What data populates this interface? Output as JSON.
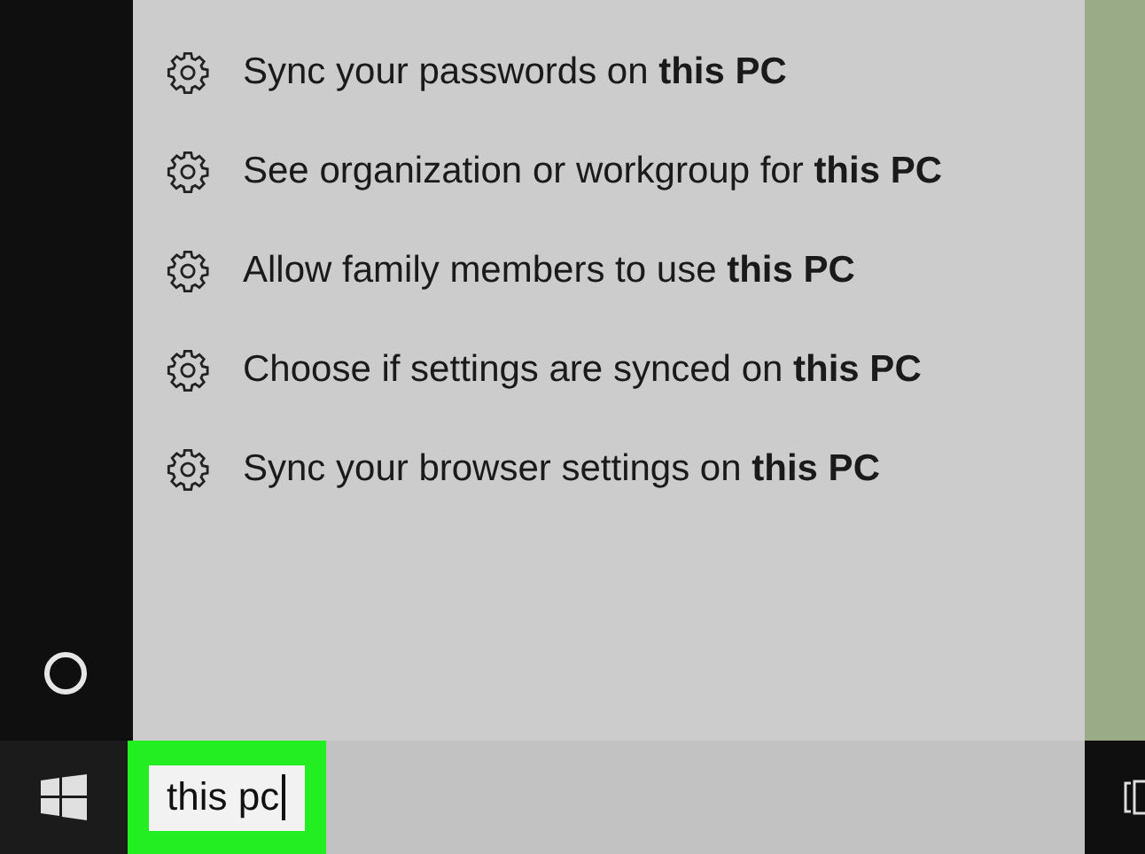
{
  "results": [
    {
      "label": "Sync your passwords on **this PC**"
    },
    {
      "label": "See organization or workgroup for **this PC**"
    },
    {
      "label": "Allow family members to use **this PC**"
    },
    {
      "label": "Choose if settings are synced on **this PC**"
    },
    {
      "label": "Sync your browser settings on **this PC**"
    }
  ],
  "search": {
    "value": "this pc"
  }
}
